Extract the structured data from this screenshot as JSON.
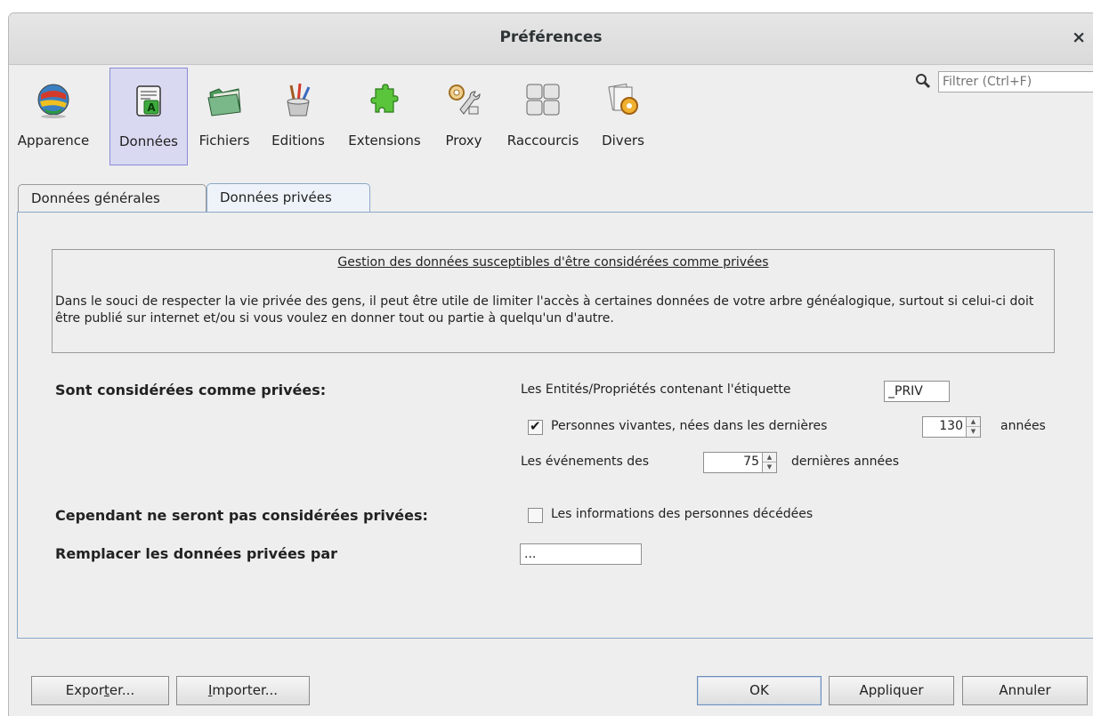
{
  "window": {
    "title": "Préférences",
    "close": "×"
  },
  "toolbar": {
    "items": [
      {
        "label": "Apparence",
        "icon": "globe-icon"
      },
      {
        "label": "Données",
        "icon": "document-icon"
      },
      {
        "label": "Fichiers",
        "icon": "folder-icon"
      },
      {
        "label": "Editions",
        "icon": "paint-brushes-icon"
      },
      {
        "label": "Extensions",
        "icon": "puzzle-icon"
      },
      {
        "label": "Proxy",
        "icon": "wrench-gear-icon"
      },
      {
        "label": "Raccourcis",
        "icon": "keyboard-keys-icon"
      },
      {
        "label": "Divers",
        "icon": "papers-gear-icon"
      }
    ],
    "selected": "Données"
  },
  "search": {
    "placeholder": "Filtrer (Ctrl+F)"
  },
  "tabs": [
    {
      "label": "Données générales",
      "active": false
    },
    {
      "label": "Données privées",
      "active": true
    }
  ],
  "info": {
    "title": "Gestion des données susceptibles d'être considérées comme privées",
    "text": "Dans le souci de respecter la vie privée des gens, il peut être utile de limiter l'accès à certaines données de votre arbre généalogique, surtout si celui-ci doit être publié sur internet et/ou si vous voulez en donner tout ou partie à quelqu'un d'autre."
  },
  "private": {
    "section_label": "Sont considérées comme privées:",
    "tag_label": "Les Entités/Propriétés contenant l'étiquette",
    "tag_value": "_PRIV",
    "living_checked": true,
    "living_label": "Personnes vivantes, nées dans les dernières",
    "living_years": "130",
    "living_unit": "années",
    "events_label": "Les événements des",
    "events_years": "75",
    "events_unit": "dernières années"
  },
  "exceptions": {
    "section_label": "Cependant ne seront pas considérées privées:",
    "deceased_checked": false,
    "deceased_label": "Les informations des personnes décédées"
  },
  "replace": {
    "section_label": "Remplacer les données privées par",
    "value": "..."
  },
  "buttons": {
    "export_pre": "Expor",
    "export_mn": "t",
    "export_post": "er...",
    "import_mn": "I",
    "import_post": "mporter...",
    "ok": "OK",
    "apply": "Appliquer",
    "cancel": "Annuler"
  }
}
